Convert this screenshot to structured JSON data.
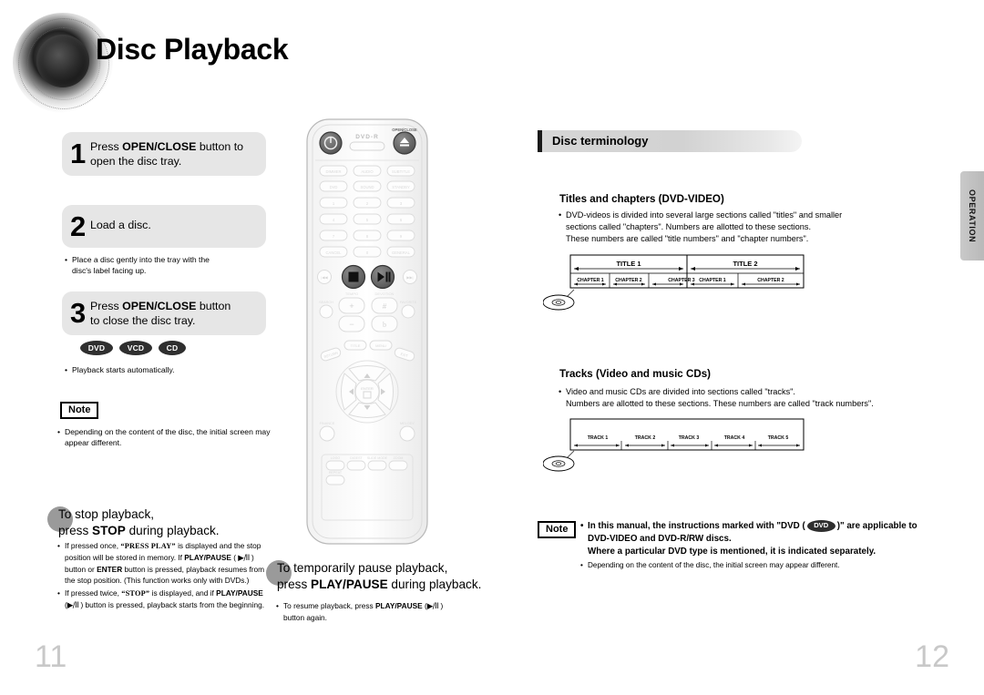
{
  "header": {
    "title": "Disc Playback",
    "logo_icon": "speaker-icon"
  },
  "left_page": {
    "page_number": "11",
    "steps": [
      {
        "num": "1",
        "line1_pre": "Press ",
        "line1_bold": "OPEN/CLOSE",
        "line1_post": " button to",
        "line2": "open the disc tray."
      },
      {
        "num": "2",
        "line1_pre": "",
        "line1_bold": "",
        "line1_post": "Load a disc.",
        "line2": ""
      },
      {
        "num": "3",
        "line1_pre": "Press ",
        "line1_bold": "OPEN/CLOSE",
        "line1_post": " button",
        "line2": "to close the disc tray."
      }
    ],
    "step2_bullets": [
      "Place a disc gently into the tray with the",
      "disc's label facing up."
    ],
    "format_badges": [
      "DVD",
      "VCD",
      "CD"
    ],
    "step3_bullet": "Playback starts automatically.",
    "note_label": "Note",
    "note_bullets": [
      "Depending on the content of the disc, the initial screen may",
      "appear different."
    ],
    "stop_section": {
      "head_line1": "To stop playback,",
      "head_line2_pre": "press ",
      "head_line2_bold": "STOP",
      "head_line2_post": " during playback.",
      "bullets": [
        "If pressed once, “PRESS PLAY” is displayed and the stop position will be stored in memory. If PLAY/PAUSE ( ▶/II ) button or ENTER button is pressed, playback resumes from the stop position. (This function works only with DVDs.)",
        "If pressed twice, “STOP” is displayed, and if PLAY/PAUSE ( ▶/II ) button is pressed, playback starts from the beginning."
      ]
    },
    "pause_section": {
      "head_line1": "To temporarily pause playback,",
      "head_line2_pre": "press ",
      "head_line2_bold": "PLAY/PAUSE",
      "head_line2_post": " during playback.",
      "bullet_line1_pre": "To resume playback, press ",
      "bullet_line1_bold": "PLAY/PAUSE",
      "bullet_line1_post": " ( ▶/II )",
      "bullet_line2": "button again."
    }
  },
  "remote": {
    "name": "remote-control-illustration",
    "brand_label": "DVD-R",
    "open_close_label": "OPEN/CLOSE",
    "power_icon": "power-icon",
    "eject_icon": "eject-icon",
    "stop_icon": "stop-icon",
    "play_pause_icon": "play-pause-icon",
    "enter_label": "ENTER",
    "keypad": [
      "1",
      "2",
      "3",
      "4",
      "5",
      "6",
      "7",
      "8",
      "9",
      "0"
    ],
    "row_labels_top": [
      "DIMMER",
      "AUDIO",
      "SUBTITLE"
    ],
    "row_labels_2": [
      "DVD\nRECEIVER",
      "SOUND",
      "STANDBY"
    ],
    "bottom_row": [
      "LOGO",
      "DIGEST",
      "SLIDE MODE",
      "ZOOM"
    ],
    "repeat_label": "REPEAT",
    "cancel_label": "CANCEL",
    "general_label": "GENERAL",
    "tempo_label": "TEMPO",
    "devotion_label": "DEVOTION",
    "finance_label": "FINANCE",
    "melody_label": "MELODY",
    "return_label": "RETURN",
    "title_label": "TITLE",
    "menu_label": "MENU",
    "info_label": "INFO",
    "exit_label": "EXIT"
  },
  "right_page": {
    "page_number": "12",
    "section_title": "Disc terminology",
    "titles_chapters": {
      "heading": "Titles and chapters (DVD-VIDEO)",
      "body": [
        "DVD-videos is divided into several large sections called \"titles\" and smaller",
        "sections called \"chapters\". Numbers are allotted to these sections.",
        "These numbers are called \"title numbers\" and \"chapter numbers\"."
      ],
      "diagram": {
        "titles": [
          "TITLE 1",
          "TITLE 2"
        ],
        "chapters_title1": [
          "CHAPTER 1",
          "CHAPTER 2",
          "CHAPTER 3"
        ],
        "chapters_title2": [
          "CHAPTER 1",
          "CHAPTER 2"
        ],
        "disc_icon": "disc-icon"
      }
    },
    "tracks": {
      "heading": "Tracks (Video and music CDs)",
      "body": [
        "Video and music CDs are divided into sections called \"tracks\".",
        "Numbers are allotted to these sections. These numbers are called \"track numbers\"."
      ],
      "diagram": {
        "tracks": [
          "TRACK 1",
          "TRACK 2",
          "TRACK 3",
          "TRACK 4",
          "TRACK 5"
        ],
        "disc_icon": "disc-icon"
      }
    },
    "note": {
      "label": "Note",
      "line1_pre": "In this manual, the instructions marked with \"DVD (",
      "badge": "DVD",
      "line1_post": ")\" are applicable to",
      "line2": "DVD-VIDEO and DVD-R/RW discs.",
      "line3": "Where a particular DVD type is mentioned, it is indicated separately.",
      "line4": "Depending on the content of the disc, the initial screen may appear different."
    }
  },
  "side_tab": {
    "label": "OPERATION"
  },
  "colors": {
    "step_bg": "#e6e6e6",
    "badge_bg": "#2f2f2f",
    "page_number": "#c8c8c8",
    "section_bar": "#d4d4d4",
    "tab_bg": "#c3c3c3"
  }
}
